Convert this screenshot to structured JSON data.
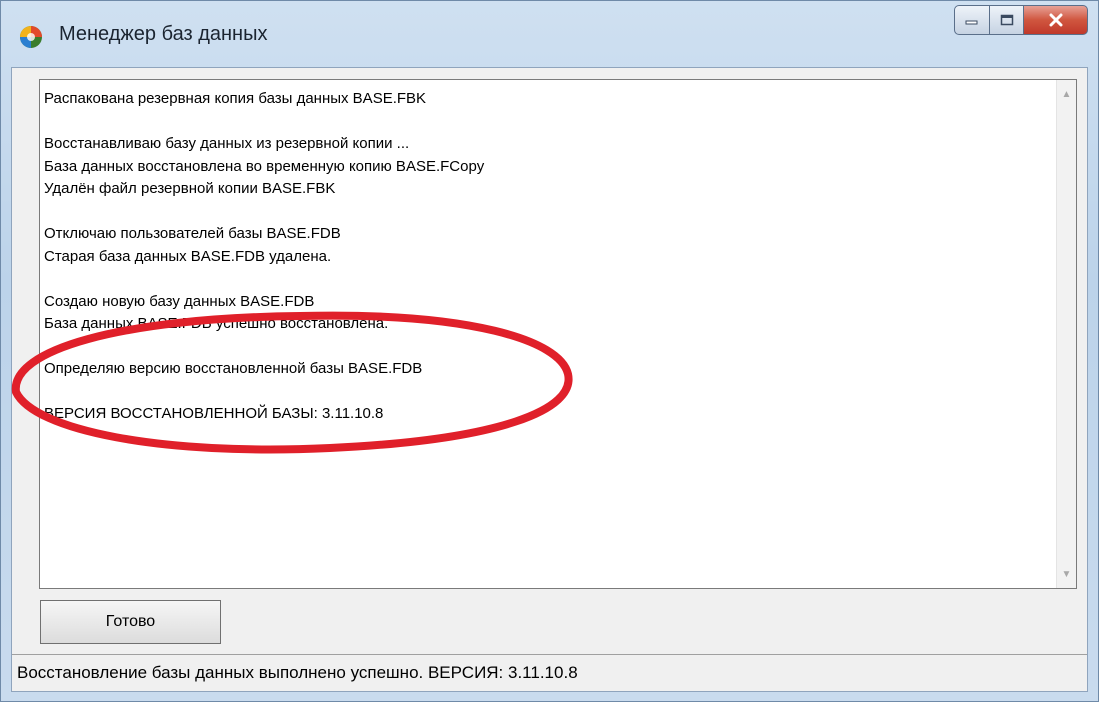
{
  "window": {
    "title": "Менеджер баз данных",
    "icon": "app-icon"
  },
  "caption_buttons": {
    "minimize_icon": "minimize-icon",
    "maximize_icon": "maximize-icon",
    "close_icon": "close-icon"
  },
  "log": {
    "lines": [
      "Распакована резервная копия базы данных BASE.FBK",
      "",
      "Восстанавливаю базу данных из резервной копии ...",
      "База данных восстановлена во временную копию BASE.FCopy",
      "Удалён файл резервной копии BASE.FBK",
      "",
      "Отключаю пользователей базы BASE.FDB",
      "Старая база данных BASE.FDB удалена.",
      "",
      "Создаю новую базу данных BASE.FDB",
      "База данных BASE.FDB успешно восстановлена.",
      "",
      "Определяю версию восстановленной базы BASE.FDB",
      "",
      "ВЕРСИЯ ВОССТАНОВЛЕННОЙ БАЗЫ: 3.11.10.8"
    ]
  },
  "buttons": {
    "done_label": "Готово"
  },
  "status": {
    "text": "Восстановление базы данных выполнено успешно. ВЕРСИЯ: 3.11.10.8"
  },
  "colors": {
    "annotation": "#e0202a",
    "close_button": "#c0392b"
  }
}
